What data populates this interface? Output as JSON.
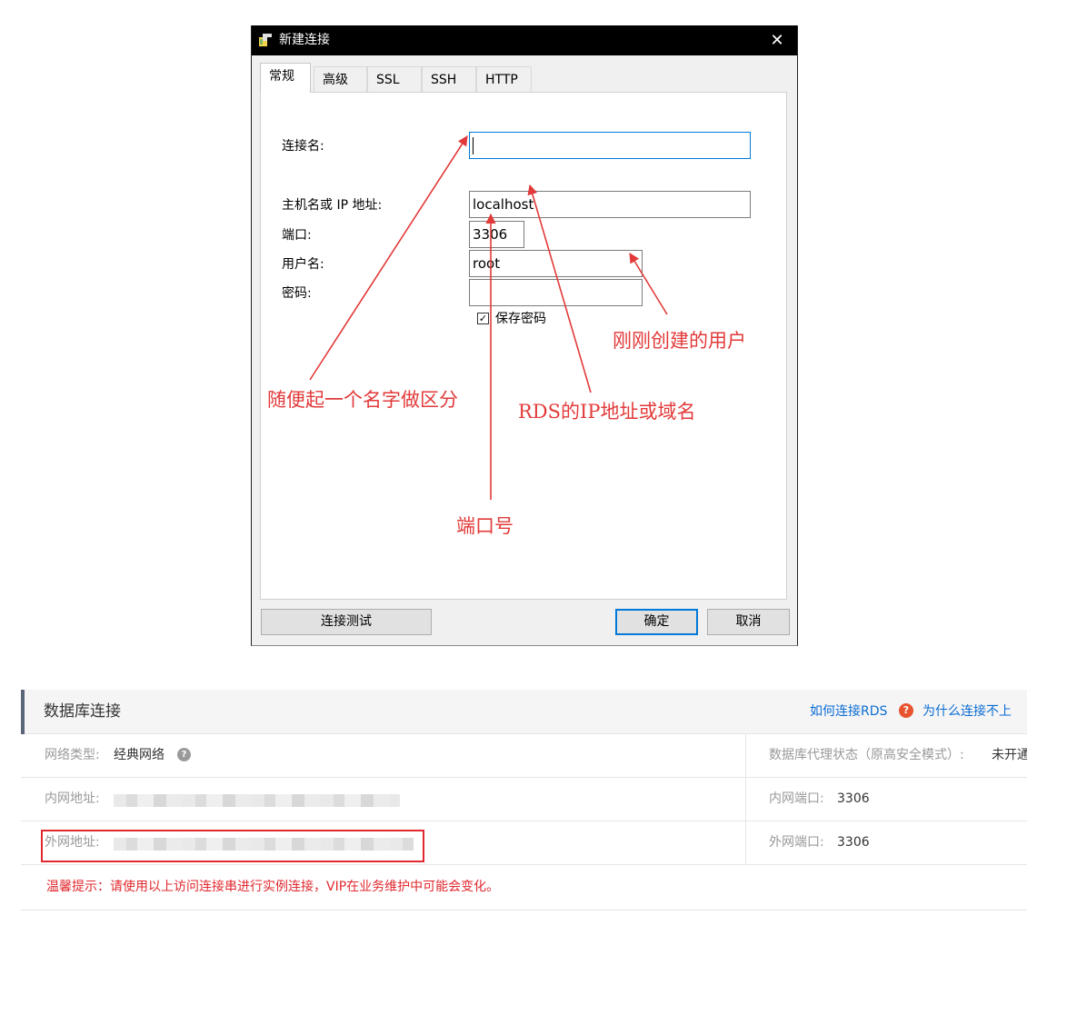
{
  "dialog": {
    "title": "新建连接",
    "close_glyph": "✕",
    "tabs": [
      {
        "label": "常规",
        "active": true
      },
      {
        "label": "高级",
        "active": false
      },
      {
        "label": "SSL",
        "active": false
      },
      {
        "label": "SSH",
        "active": false
      },
      {
        "label": "HTTP",
        "active": false
      }
    ],
    "fields": {
      "connection_name": {
        "label": "连接名:",
        "value": ""
      },
      "host": {
        "label": "主机名或 IP 地址:",
        "value": "localhost"
      },
      "port": {
        "label": "端口:",
        "value": "3306"
      },
      "username": {
        "label": "用户名:",
        "value": "root"
      },
      "password": {
        "label": "密码:",
        "value": ""
      }
    },
    "save_password": {
      "label": "保存密码",
      "checked": true,
      "glyph": "✓"
    },
    "buttons": {
      "test": "连接测试",
      "ok": "确定",
      "cancel": "取消"
    }
  },
  "annotations": {
    "color": "#e23a3a",
    "name_hint": "随便起一个名字做区分",
    "host_hint": "RDS的IP地址或域名",
    "port_hint": "端口号",
    "user_hint": "刚刚创建的用户"
  },
  "db_panel": {
    "title": "数据库连接",
    "links": {
      "how_to_connect": "如何连接RDS",
      "why_fail": "为什么连接不上"
    },
    "help_glyph": "?",
    "rows": [
      {
        "label": "网络类型:",
        "value": "经典网络",
        "right_label": "数据库代理状态（原高安全模式）:",
        "right_value": "未开通"
      },
      {
        "label": "内网地址:",
        "right_label": "内网端口:",
        "right_value": "3306"
      },
      {
        "label": "外网地址:",
        "right_label": "外网端口:",
        "right_value": "3306"
      }
    ],
    "tip": "温馨提示：请使用以上访问连接串进行实例连接，VIP在业务维护中可能会变化。"
  }
}
